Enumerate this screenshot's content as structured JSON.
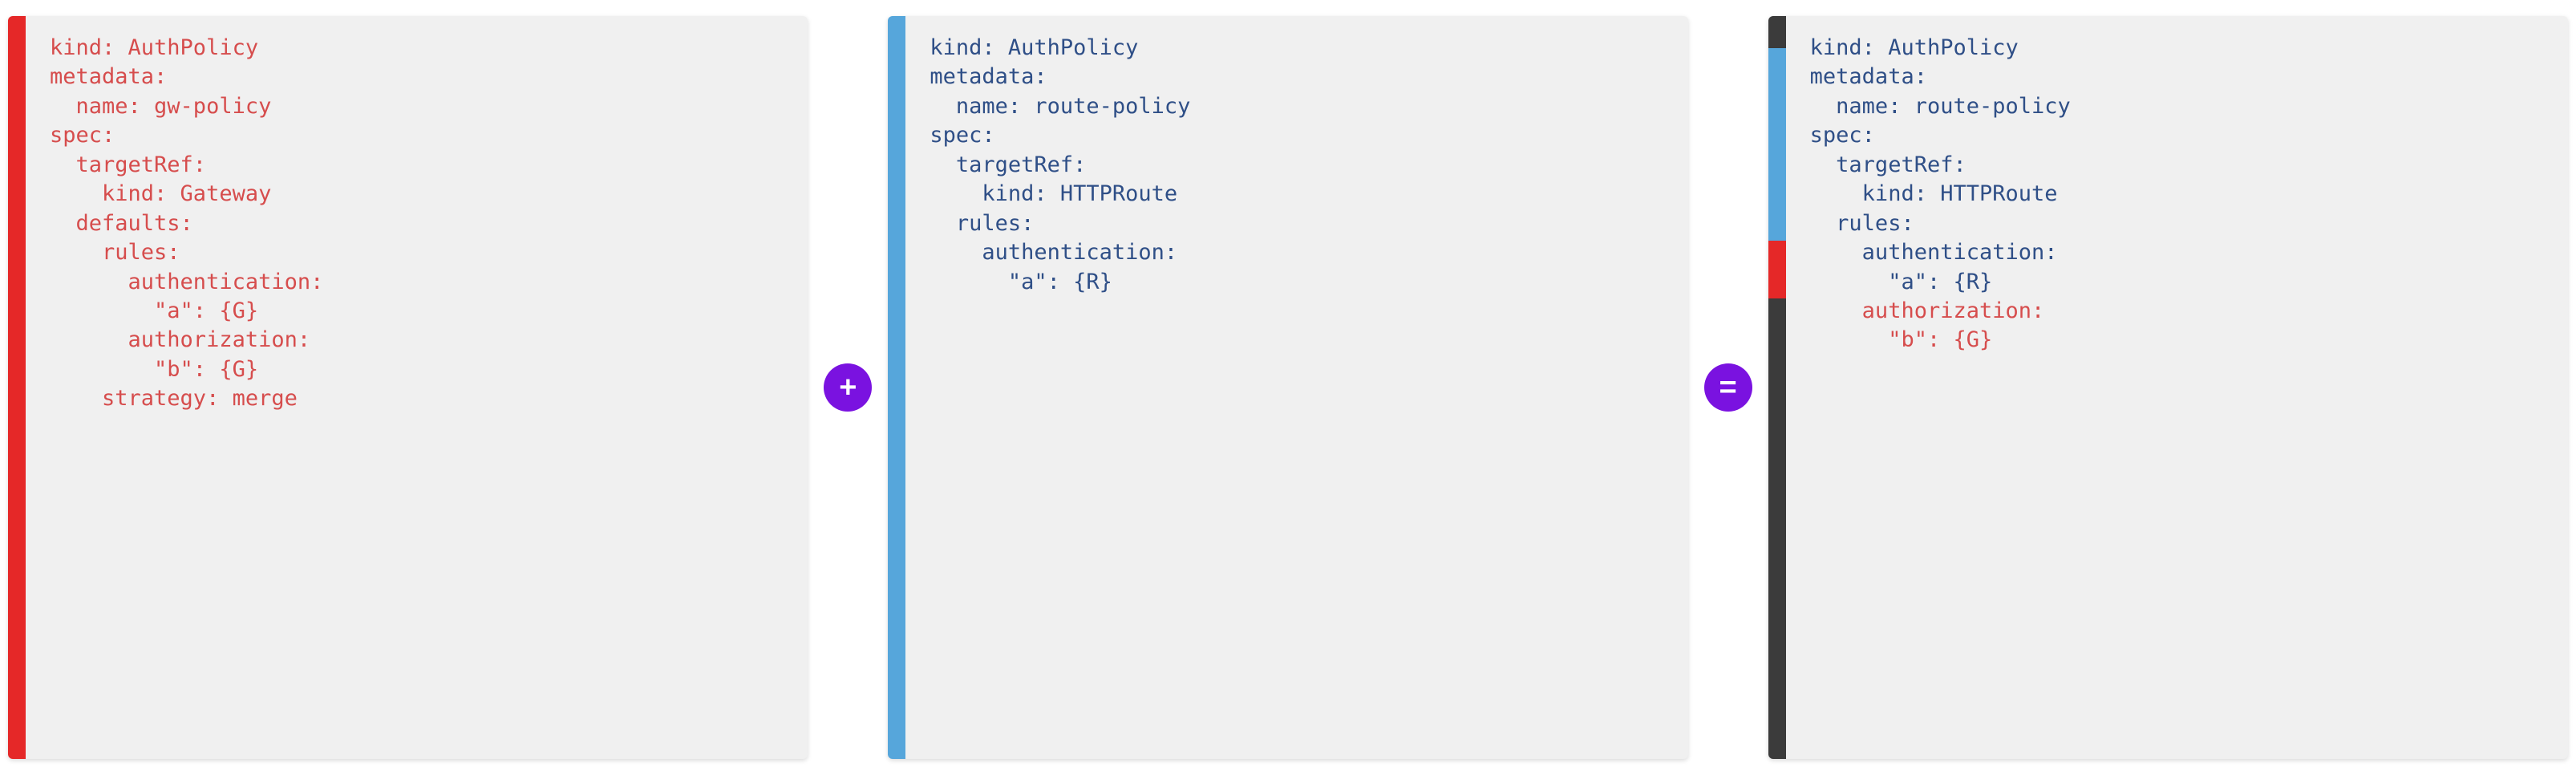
{
  "operators": {
    "plus": "+",
    "equals": "="
  },
  "colors": {
    "red": "#e52828",
    "blue": "#56a6db",
    "dark": "#3b3b3b",
    "purple": "#7a12e0",
    "panel_bg": "#f0f0f0",
    "code_red": "#d64d4d",
    "code_blue": "#2f4f87"
  },
  "panel1": {
    "accent": "red",
    "text": "kind: AuthPolicy\nmetadata:\n  name: gw-policy\nspec:\n  targetRef:\n    kind: Gateway\n  defaults:\n    rules:\n      authentication:\n        \"a\": {G}\n      authorization:\n        \"b\": {G}\n    strategy: merge"
  },
  "panel2": {
    "accent": "blue",
    "text": "kind: AuthPolicy\nmetadata:\n  name: route-policy\nspec:\n  targetRef:\n    kind: HTTPRoute\n  rules:\n    authentication:\n      \"a\": {R}"
  },
  "panel3": {
    "accents": [
      "dark",
      "blue",
      "red",
      "dark"
    ],
    "blue_text": "kind: AuthPolicy\nmetadata:\n  name: route-policy\nspec:\n  targetRef:\n    kind: HTTPRoute\n  rules:\n    authentication:\n      \"a\": {R}",
    "red_text": "    authorization:\n      \"b\": {G}"
  }
}
